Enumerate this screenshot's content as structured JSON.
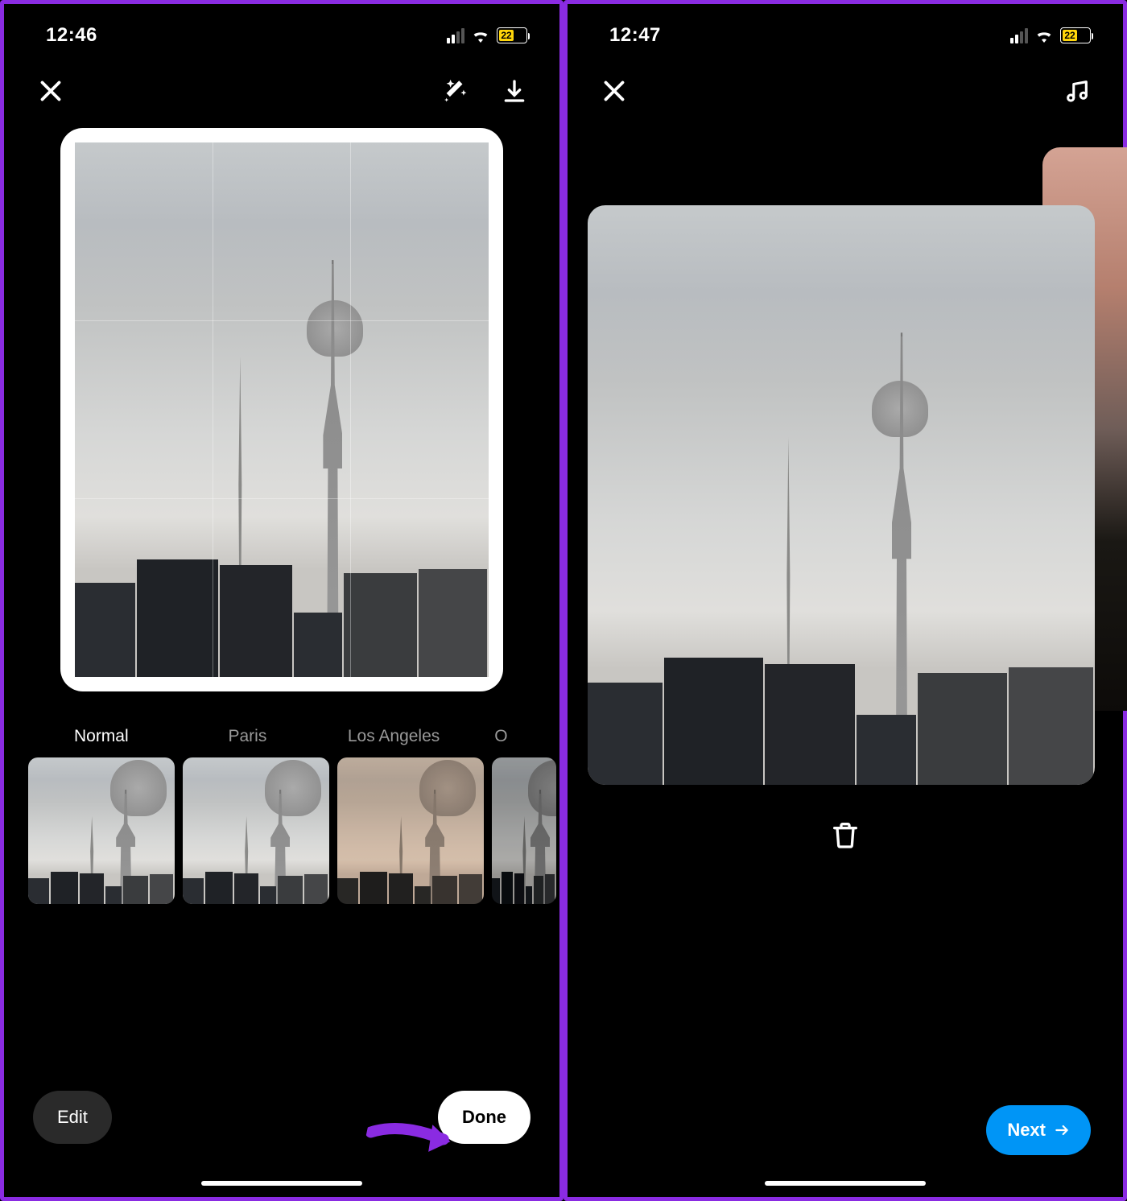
{
  "left": {
    "status": {
      "time": "12:46",
      "battery": "22"
    },
    "filters": [
      {
        "label": "Normal",
        "active": true
      },
      {
        "label": "Paris",
        "active": false
      },
      {
        "label": "Los Angeles",
        "active": false
      },
      {
        "label": "O",
        "active": false
      }
    ],
    "buttons": {
      "edit": "Edit",
      "done": "Done"
    }
  },
  "right": {
    "status": {
      "time": "12:47",
      "battery": "22"
    },
    "buttons": {
      "next": "Next"
    }
  }
}
